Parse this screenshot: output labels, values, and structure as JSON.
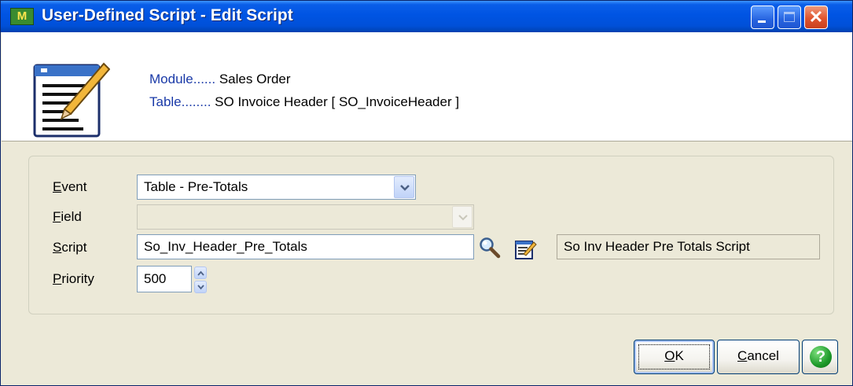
{
  "window": {
    "title": "User-Defined Script - Edit Script",
    "app_icon_text": "M",
    "controls": {
      "minimize": "minimize",
      "maximize": "maximize",
      "close": "close"
    },
    "close_glyph": "✕"
  },
  "header": {
    "module_label": "Module......",
    "module_value": "Sales Order",
    "table_label": "Table........",
    "table_value": "SO Invoice Header  [ SO_InvoiceHeader ]"
  },
  "form": {
    "event": {
      "label_accel": "E",
      "label_rest": "vent",
      "value": "Table - Pre-Totals"
    },
    "field": {
      "label_accel": "F",
      "label_rest": "ield",
      "value": "",
      "disabled": true
    },
    "script": {
      "label_accel": "S",
      "label_rest": "cript",
      "value": "So_Inv_Header_Pre_Totals",
      "description": "So Inv Header Pre Totals Script"
    },
    "priority": {
      "label_accel": "P",
      "label_rest": "riority",
      "value": "500"
    }
  },
  "buttons": {
    "ok_accel": "O",
    "ok_rest": "K",
    "cancel_accel": "C",
    "cancel_rest": "ancel",
    "help": "?"
  },
  "icons": [
    "app-icon",
    "script-document-icon",
    "magnifier-icon",
    "edit-script-icon",
    "help-icon"
  ]
}
